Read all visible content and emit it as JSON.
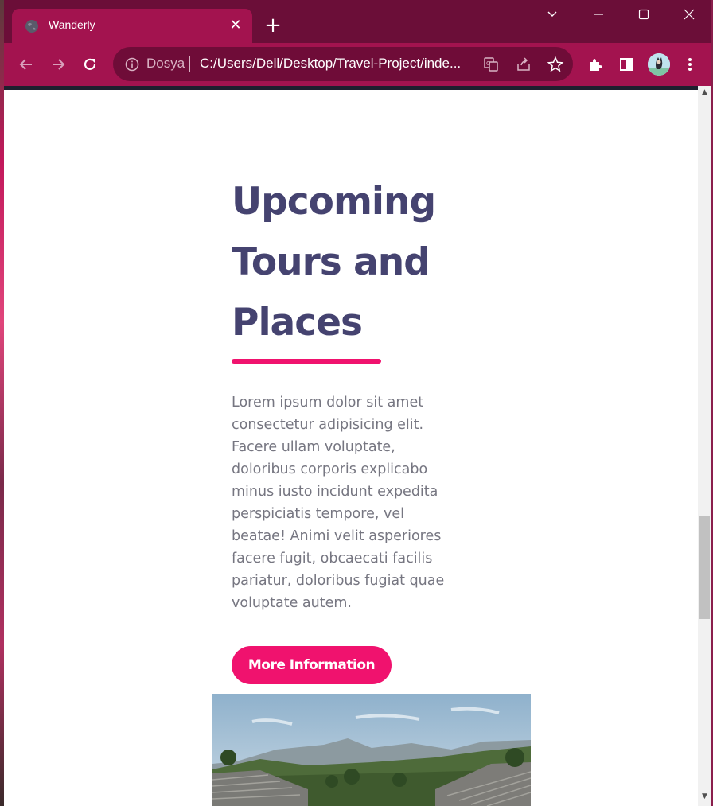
{
  "browser": {
    "tab_title": "Wanderly",
    "omnibox": {
      "scheme_label": "Dosya",
      "url": "C:/Users/Dell/Desktop/Travel-Project/inde..."
    }
  },
  "page": {
    "heading": "Upcoming Tours and Places",
    "body": "Lorem ipsum dolor sit amet consectetur adipisicing elit. Facere ullam voluptate, doloribus corporis explicabo minus iusto incidunt expedita perspiciatis tempore, vel beatae! Animi velit asperiores facere fugit, obcaecati facilis pariatur, doloribus fugiat quae voluptate autem.",
    "cta_label": "More Information"
  },
  "colors": {
    "browser_frame": "#a3134f",
    "heading": "#454370",
    "accent": "#f0126e",
    "body_text": "#767681"
  },
  "icons": [
    "globe-icon",
    "close-icon",
    "plus-icon",
    "chevron-down-icon",
    "minimize-icon",
    "maximize-icon",
    "back-icon",
    "forward-icon",
    "reload-icon",
    "info-icon",
    "translate-icon",
    "share-icon",
    "star-icon",
    "extensions-icon",
    "side-panel-icon",
    "menu-icon"
  ]
}
